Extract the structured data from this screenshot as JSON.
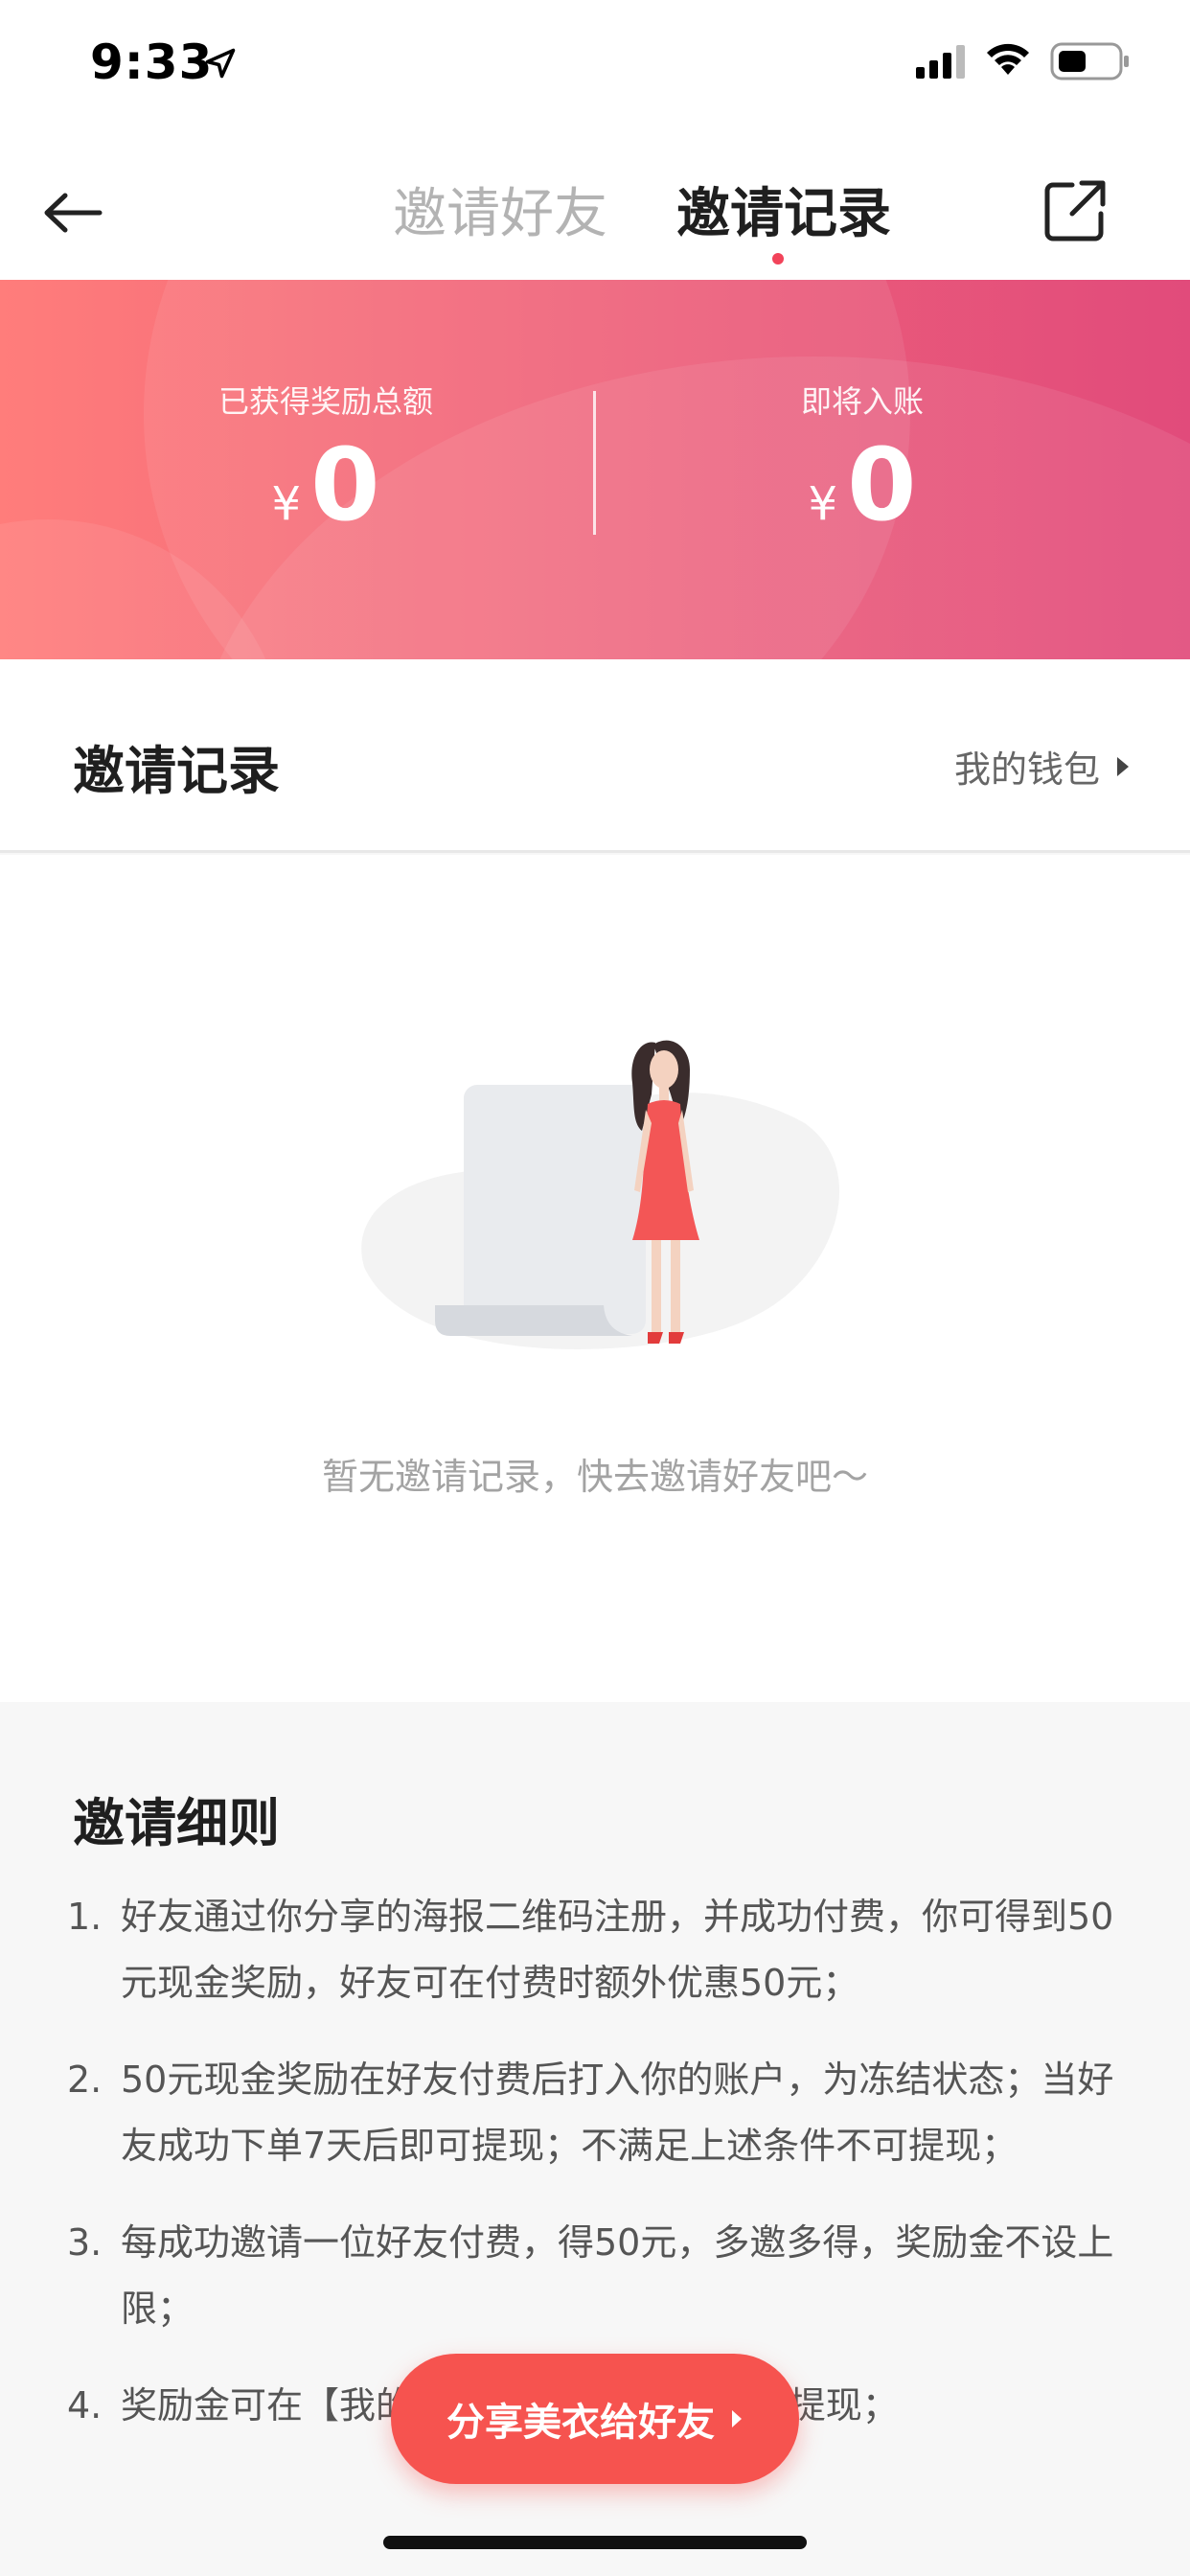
{
  "status_bar": {
    "time": "9:33"
  },
  "nav": {
    "tabs": [
      {
        "label": "邀请好友",
        "active": false
      },
      {
        "label": "邀请记录",
        "active": true
      }
    ],
    "accent_color": "#f2435a"
  },
  "banner": {
    "earned_label": "已获得奖励总额",
    "earned_currency": "¥",
    "earned_amount": "0",
    "pending_label": "即将入账",
    "pending_currency": "¥",
    "pending_amount": "0",
    "gradient": [
      "#ff7d7b",
      "#e14b7b"
    ]
  },
  "records": {
    "title": "邀请记录",
    "wallet_link": "我的钱包",
    "empty_text": "暂无邀请记录，快去邀请好友吧～"
  },
  "rules": {
    "title": "邀请细则",
    "items": [
      {
        "num": "1.",
        "text": "好友通过你分享的海报二维码注册，并成功付费，你可得到50元现金奖励，好友可在付费时额外优惠50元；"
      },
      {
        "num": "2.",
        "text": "50元现金奖励在好友付费后打入你的账户，为冻结状态；当好友成功下单7天后即可提现；不满足上述条件不可提现；"
      },
      {
        "num": "3.",
        "text": "每成功邀请一位好友付费，得50元，多邀多得，奖励金不设上限；"
      },
      {
        "num": "4.",
        "text": "奖励金可在【我的】-【我的钱包】查询并提现；"
      }
    ]
  },
  "cta": {
    "label": "分享美衣给好友",
    "color": "#f6534f"
  },
  "icons": {
    "location": "location-arrow-icon",
    "signal": "cellular-signal-icon",
    "wifi": "wifi-icon",
    "battery": "battery-icon",
    "back": "back-arrow-icon",
    "share": "share-external-icon",
    "chevron": "chevron-right-icon"
  }
}
